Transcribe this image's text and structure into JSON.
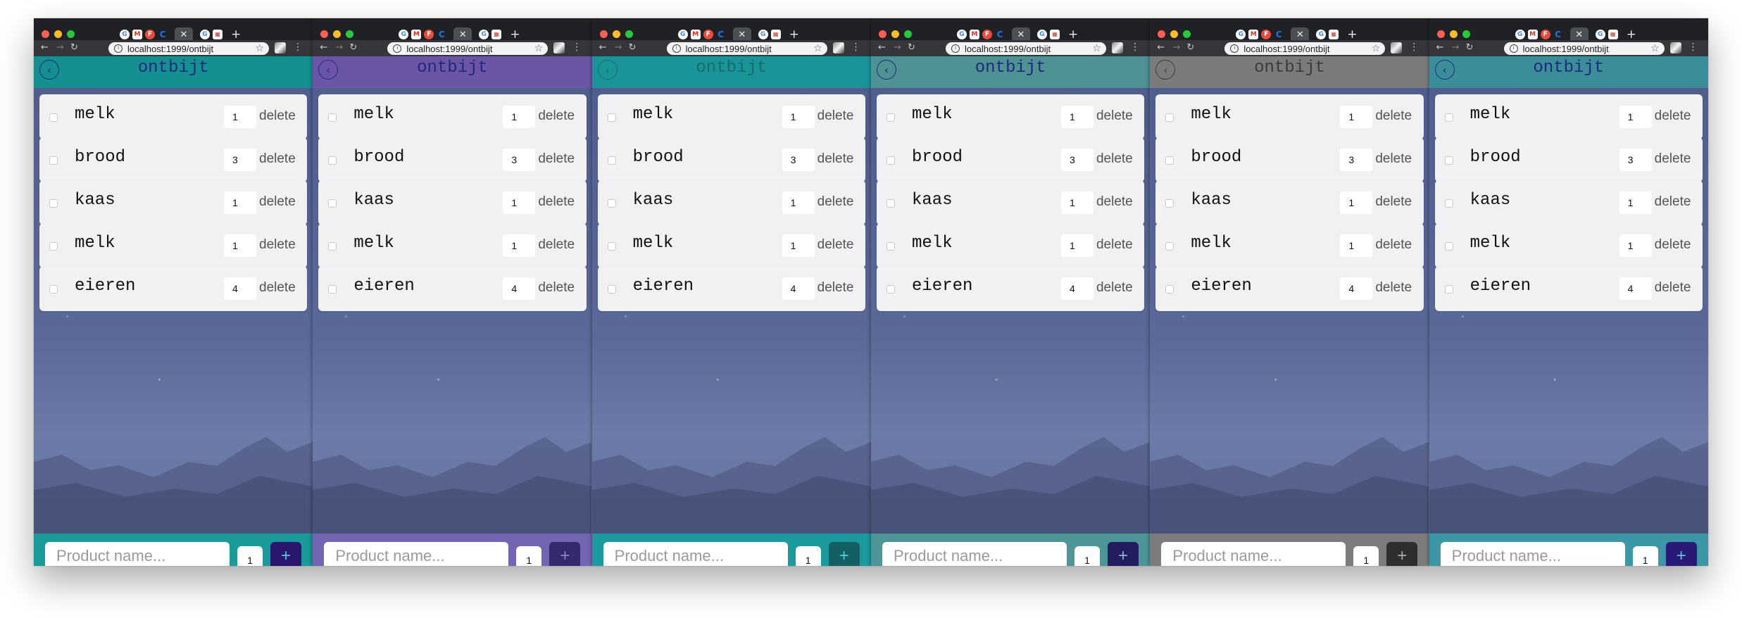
{
  "browser": {
    "url": "localhost:1999/ontbijt",
    "tab_icons": [
      "google-icon",
      "gmail-icon",
      "flash-icon",
      "chrome-icon",
      "close-icon",
      "google-icon",
      "calendar-icon",
      "plus-icon"
    ]
  },
  "app": {
    "title": "ontbijt",
    "items": [
      {
        "name": "melk",
        "qty": "1"
      },
      {
        "name": "brood",
        "qty": "3"
      },
      {
        "name": "kaas",
        "qty": "1"
      },
      {
        "name": "melk",
        "qty": "1"
      },
      {
        "name": "eieren",
        "qty": "4"
      }
    ],
    "delete_label": "delete",
    "new_product_placeholder": "Product name...",
    "new_qty": "1",
    "add_label": "+"
  },
  "themes": [
    {
      "header": "#158f8f",
      "title": "#1e2a7e",
      "back": "#1e2a7e",
      "footer": "#1a9a9a",
      "add_bg": "#2a166f",
      "add_fg": "#4ecdd6"
    },
    {
      "header": "#6c55a6",
      "title": "#1e2a7e",
      "back": "#1e2a7e",
      "footer": "#7465b2",
      "add_bg": "#35286b",
      "add_fg": "#8b86cc"
    },
    {
      "header": "#19959a",
      "title": "#1a6a6c",
      "back": "#1a6a6c",
      "footer": "#1a9a9e",
      "add_bg": "#145f63",
      "add_fg": "#4ecdd6"
    },
    {
      "header": "#4f9294",
      "title": "#1e2a7e",
      "back": "#1e2a7e",
      "footer": "#4e9598",
      "add_bg": "#231d5f",
      "add_fg": "#87b9c9"
    },
    {
      "header": "#7b7b7b",
      "title": "#3b3b3b",
      "back": "#3b3b3b",
      "footer": "#7c7c7c",
      "add_bg": "#2e2e2e",
      "add_fg": "#a9a9a9"
    },
    {
      "header": "#3b8e99",
      "title": "#1e2a7e",
      "back": "#1e2a7e",
      "footer": "#3b96a5",
      "add_bg": "#2a1977",
      "add_fg": "#66c0d8"
    }
  ]
}
